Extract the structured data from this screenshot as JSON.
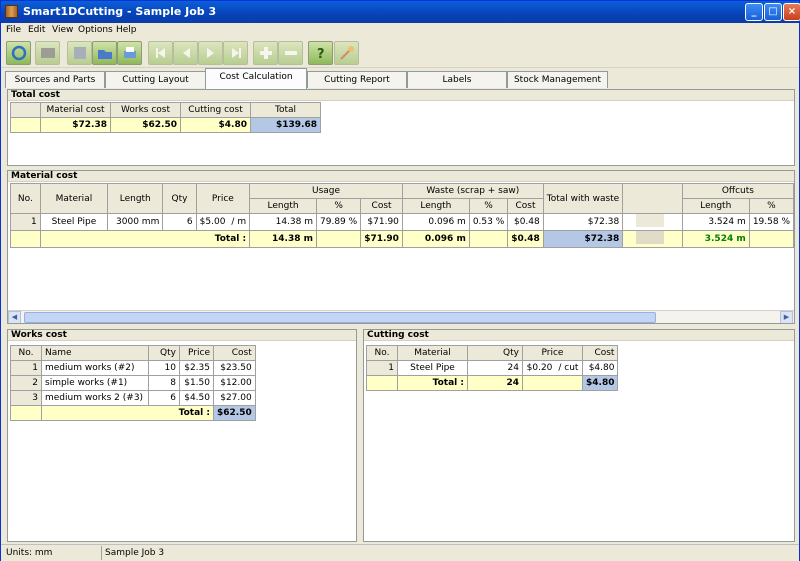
{
  "window": {
    "title": "Smart1DCutting - Sample Job 3"
  },
  "menu": [
    "File",
    "Edit",
    "View",
    "Options",
    "Help"
  ],
  "toolbar": {
    "icons": [
      "refresh-icon",
      "calculator-icon",
      "save-icon",
      "open-icon",
      "print-icon",
      "first-icon",
      "prev-icon",
      "next-icon",
      "last-icon",
      "add-icon",
      "remove-icon",
      "help-icon",
      "wizard-icon"
    ]
  },
  "tabs": [
    "Sources and Parts",
    "Cutting Layout",
    "Cost Calculation",
    "Cutting Report",
    "Labels",
    "Stock Management"
  ],
  "active_tab": "Cost Calculation",
  "total_cost": {
    "title": "Total cost",
    "headers": [
      "Material cost",
      "Works cost",
      "Cutting cost",
      "Total"
    ],
    "values": [
      "$72.38",
      "$62.50",
      "$4.80",
      "$139.68"
    ]
  },
  "material_cost": {
    "title": "Material cost",
    "headers": {
      "no": "No.",
      "material": "Material",
      "length": "Length",
      "qty": "Qty",
      "price": "Price",
      "usage": "Usage",
      "waste": "Waste  (scrap + saw)",
      "total_with_waste": "Total with waste",
      "offcuts": "Offcuts",
      "sub_length": "Length",
      "sub_pct": "%",
      "sub_cost": "Cost"
    },
    "row": {
      "no": "1",
      "material": "Steel Pipe",
      "length": "3000 mm",
      "qty": "6",
      "price": "$5.00",
      "unit": "/ m",
      "usage_length": "14.38 m",
      "usage_pct": "79.89 %",
      "usage_cost": "$71.90",
      "waste_length": "0.096 m",
      "waste_pct": "0.53 %",
      "waste_cost": "$0.48",
      "total_with_waste": "$72.38",
      "offcut_length": "3.524 m",
      "offcut_pct": "19.58 %"
    },
    "total": {
      "label": "Total :",
      "usage_length": "14.38 m",
      "usage_cost": "$71.90",
      "waste_length": "0.096 m",
      "waste_cost": "$0.48",
      "total_with_waste": "$72.38",
      "offcut_length": "3.524 m"
    }
  },
  "works_cost": {
    "title": "Works cost",
    "headers": [
      "No.",
      "Name",
      "Qty",
      "Price",
      "Cost"
    ],
    "rows": [
      [
        "1",
        "medium works (#2)",
        "10",
        "$2.35",
        "$23.50"
      ],
      [
        "2",
        "simple works (#1)",
        "8",
        "$1.50",
        "$12.00"
      ],
      [
        "3",
        "medium works 2 (#3)",
        "6",
        "$4.50",
        "$27.00"
      ]
    ],
    "total_label": "Total :",
    "total": "$62.50"
  },
  "cutting_cost": {
    "title": "Cutting cost",
    "headers": [
      "No.",
      "Material",
      "Qty",
      "Price",
      "Cost"
    ],
    "row": {
      "no": "1",
      "material": "Steel Pipe",
      "qty": "24",
      "price": "$0.20",
      "unit": "/ cut",
      "cost": "$4.80"
    },
    "total_label": "Total :",
    "total_qty": "24",
    "total": "$4.80"
  },
  "status": {
    "units": "Units: mm",
    "job": "Sample Job 3"
  },
  "colors": {
    "title_bar": "#0a5fd8",
    "highlight_yellow": "#ffffc8",
    "highlight_blue": "#b4c8e6",
    "offcut_green": "#008000"
  }
}
